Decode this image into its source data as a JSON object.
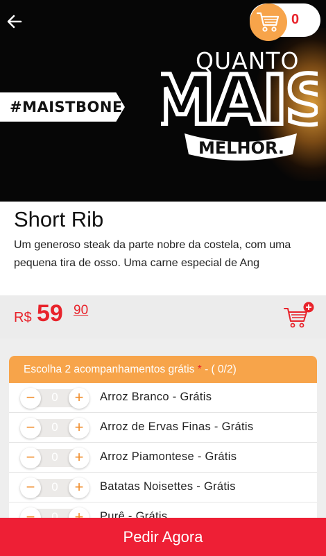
{
  "banner": {
    "hashtag": "#MAISTBONES",
    "quanto": "QUANTO",
    "mais": "MAIS",
    "melhor": "MELHOR."
  },
  "header": {
    "back_icon": "arrow-left-icon",
    "cart_icon": "shopping-cart-icon",
    "cart_count": "0"
  },
  "product": {
    "name": "Short Rib",
    "description": "Um generoso steak da parte nobre da costela, com uma pequena tira de osso. Uma carne especial de Ang",
    "currency": "R$",
    "price_integer": "59",
    "price_cents": "90",
    "add_to_cart_icon": "add-to-cart-icon"
  },
  "options": {
    "header_text": "Escolha 2 acompanhamentos grátis",
    "required_mark": "*",
    "counter": "- ( 0/2)",
    "items": [
      {
        "label": "Arroz Branco - Grátis",
        "qty": "0"
      },
      {
        "label": "Arroz de Ervas Finas - Grátis",
        "qty": "0"
      },
      {
        "label": "Arroz Piamontese - Grátis",
        "qty": "0"
      },
      {
        "label": "Batatas Noisettes - Grátis",
        "qty": "0"
      },
      {
        "label": "Purê - Grátis",
        "qty": "0"
      }
    ],
    "minus_symbol": "−",
    "plus_symbol": "+"
  },
  "footer": {
    "order_button": "Pedir Agora"
  },
  "colors": {
    "accent_orange": "#f7a44a",
    "brand_red": "#e8232b",
    "order_red": "#ee1f35"
  }
}
